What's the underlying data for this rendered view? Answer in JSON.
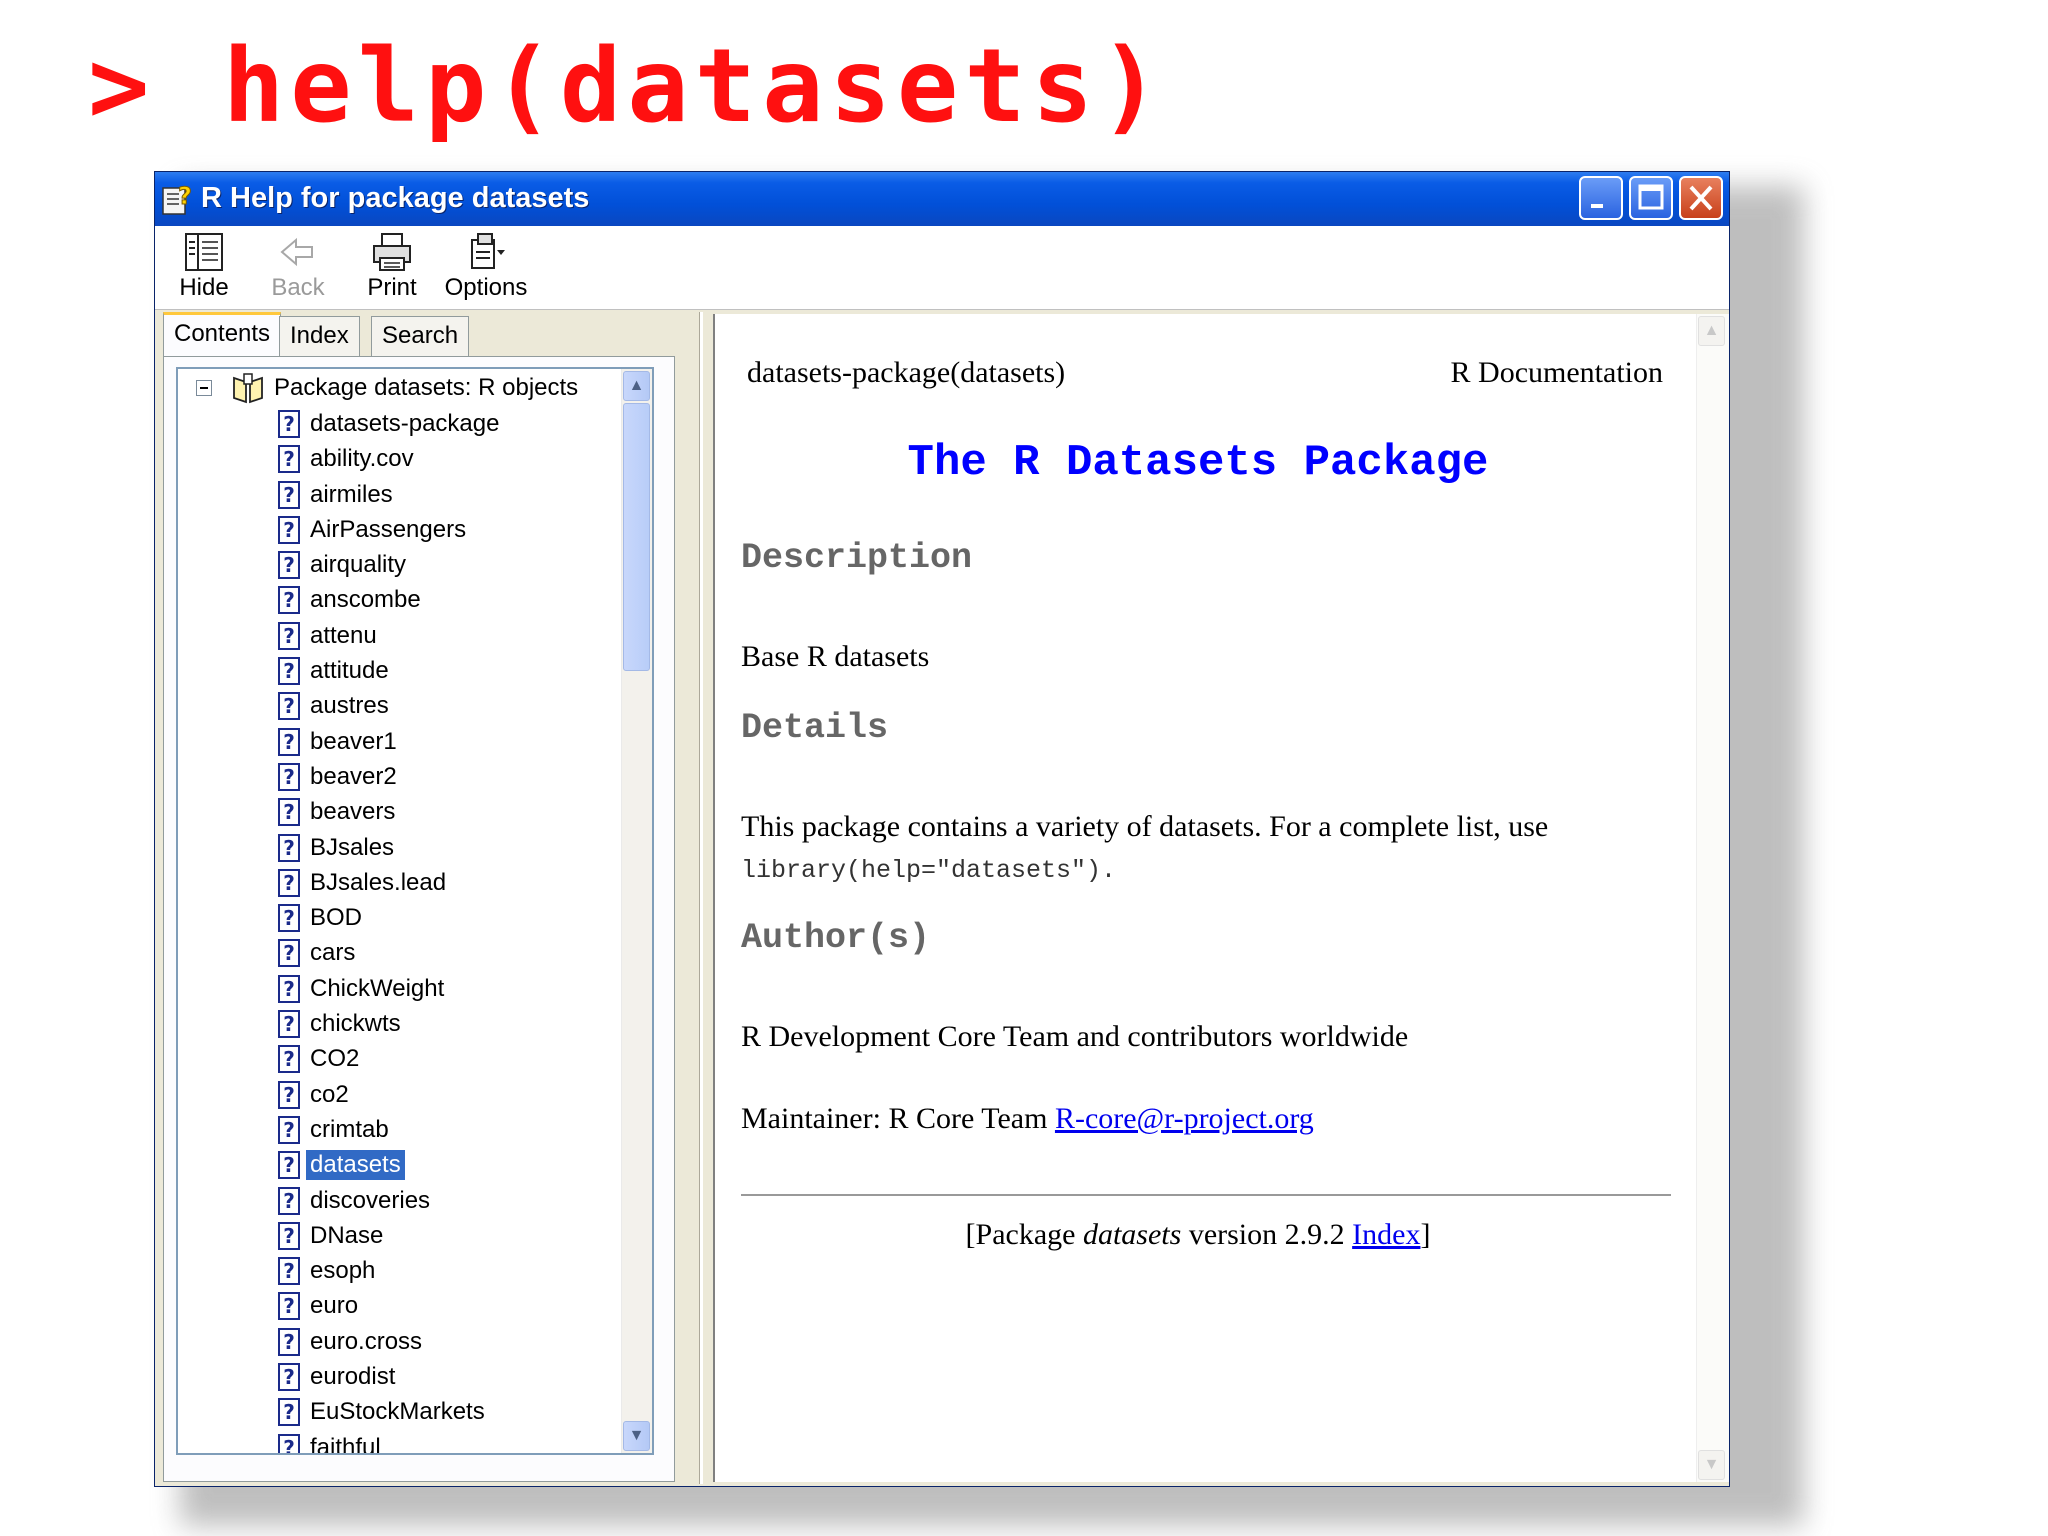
{
  "command": "> help(datasets)",
  "window": {
    "title": "R Help for package datasets"
  },
  "toolbar": {
    "hide_label": "Hide",
    "back_label": "Back",
    "print_label": "Print",
    "options_label": "Options"
  },
  "tabs": {
    "contents": "Contents",
    "index": "Index",
    "search": "Search"
  },
  "tree": {
    "root_label": "Package datasets:  R objects",
    "items": [
      "datasets-package",
      "ability.cov",
      "airmiles",
      "AirPassengers",
      "airquality",
      "anscombe",
      "attenu",
      "attitude",
      "austres",
      "beaver1",
      "beaver2",
      "beavers",
      "BJsales",
      "BJsales.lead",
      "BOD",
      "cars",
      "ChickWeight",
      "chickwts",
      "CO2",
      "co2",
      "crimtab",
      "datasets",
      "discoveries",
      "DNase",
      "esoph",
      "euro",
      "euro.cross",
      "eurodist",
      "EuStockMarkets",
      "faithful"
    ],
    "selected_item": "datasets"
  },
  "doc": {
    "name": "datasets-package(datasets)",
    "rdoc": "R Documentation",
    "title": "The R Datasets Package",
    "description_heading": "Description",
    "description_text": "Base R datasets",
    "details_heading": "Details",
    "details_text": "This package contains a variety of datasets. For a complete list, use",
    "details_code": "library(help=\"datasets\").",
    "author_heading": "Author(s)",
    "author_text": "R Development Core Team and contributors worldwide",
    "maintainer_prefix": "Maintainer: R Core Team ",
    "maintainer_email": "R-core@r-project.org",
    "footer_prefix": "[Package ",
    "footer_package": "datasets",
    "footer_version": " version 2.9.2 ",
    "footer_index_link": "Index",
    "footer_suffix": "]"
  },
  "colors": {
    "command_red": "#ff1010",
    "title_blue": "#0000ff",
    "selection_blue": "#316ac5",
    "titlebar_blue": "#0150d8"
  }
}
